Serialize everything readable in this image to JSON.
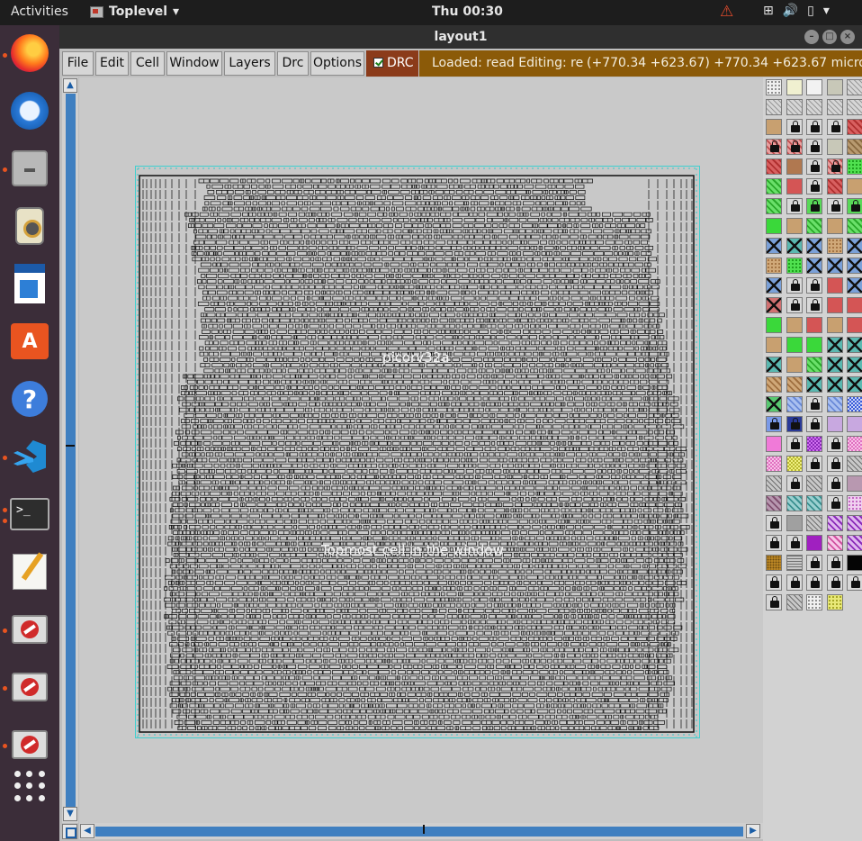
{
  "topbar": {
    "activities": "Activities",
    "app_name": "Toplevel",
    "app_chevron": "▾",
    "clock": "Thu 00:30",
    "warning_icon": "⚠",
    "tray": {
      "network": "⊞",
      "volume": "🔊",
      "battery": "▯",
      "power": "▾"
    }
  },
  "dock": {
    "items": [
      {
        "name": "firefox-icon"
      },
      {
        "name": "thunderbird-icon"
      },
      {
        "name": "files-icon"
      },
      {
        "name": "rhythmbox-icon"
      },
      {
        "name": "libreoffice-writer-icon"
      },
      {
        "name": "software-store-icon",
        "glyph": "A"
      },
      {
        "name": "help-icon",
        "glyph": "?"
      },
      {
        "name": "vscode-icon"
      },
      {
        "name": "terminal-icon",
        "glyph": ">_"
      },
      {
        "name": "text-editor-icon"
      },
      {
        "name": "blocked-app-icon"
      },
      {
        "name": "blocked-app-icon"
      },
      {
        "name": "blocked-app-icon"
      }
    ]
  },
  "window": {
    "title": "layout1",
    "controls": {
      "minimize": "–",
      "maximize": "□",
      "close": "×"
    }
  },
  "menubar": {
    "items": [
      "File",
      "Edit",
      "Cell",
      "Window",
      "Layers",
      "Drc",
      "Options"
    ],
    "drc_toggle": {
      "label": "DRC",
      "checked": true
    }
  },
  "status": {
    "message": "Loaded: read Editing: re",
    "coords": "(+770.34 +623.67) +770.34 +623.67 microns"
  },
  "canvas": {
    "cell_name": "picorv32a",
    "cell_note": "Topmost cell in the window",
    "boundary_color": "#3fd0d0"
  },
  "scrollbars": {
    "up": "▲",
    "down": "▼",
    "left": "◀",
    "right": "▶"
  },
  "palette": {
    "rows": [
      [
        "dots-white",
        "yellow-box",
        "white-box",
        "gray-solid",
        "hatch-gray"
      ],
      [
        "hatch-gray",
        "hatch-gray",
        "hatch-gray",
        "hatch-gray",
        "hatch-gray"
      ],
      [
        "tan",
        "lock",
        "lock",
        "lock",
        "red-hatch"
      ],
      [
        "lock-red",
        "lock-red",
        "lock",
        "gray-solid",
        "brown-hatch"
      ],
      [
        "red-hatch",
        "brown",
        "lock",
        "lock-red",
        "green-dots"
      ],
      [
        "green-hatch",
        "red",
        "lock",
        "red-hatch",
        "tan"
      ],
      [
        "green-hatch",
        "lock",
        "lock-green",
        "lock",
        "lock-green"
      ],
      [
        "green",
        "tan",
        "green-hatch",
        "tan",
        "green-hatch"
      ],
      [
        "x-blue",
        "x-teal",
        "x-blue",
        "tan-dots",
        "x-blue"
      ],
      [
        "tan-dots",
        "green-dots",
        "x-blue",
        "x-blue",
        "x-blue"
      ],
      [
        "x-blue",
        "lock",
        "lock",
        "red",
        "x-blue"
      ],
      [
        "x-red",
        "lock",
        "lock",
        "red",
        "red"
      ],
      [
        "green",
        "tan",
        "red",
        "tan",
        "red"
      ],
      [
        "tan",
        "green",
        "green",
        "x-teal",
        "x-teal"
      ],
      [
        "x-teal",
        "tan",
        "green-hatch",
        "x-teal",
        "x-teal"
      ],
      [
        "tan-hatch",
        "tan-hatch",
        "x-teal",
        "x-teal",
        "x-teal"
      ],
      [
        "x-green",
        "blue-hatch",
        "lock",
        "blue-hatch",
        "blue-check"
      ],
      [
        "lock-blue",
        "lock-navy",
        "lock",
        "lavender",
        "lavender"
      ],
      [
        "pink",
        "lock",
        "purple-check",
        "lock",
        "pink-check"
      ],
      [
        "pink-check",
        "yellow-check",
        "lock",
        "lock",
        "gray-hatch"
      ],
      [
        "gray-hatch",
        "lock",
        "gray-hatch",
        "lock",
        "mauve"
      ],
      [
        "mauve-hatch",
        "teal-hatch",
        "teal-hatch",
        "lock",
        "pink-dots"
      ],
      [
        "lock",
        "gray",
        "gray-hatch",
        "purple-hatch",
        "purple-hatch"
      ],
      [
        "lock",
        "lock",
        "purple",
        "pink-hatch",
        "purple-hatch"
      ],
      [
        "orange-speckle",
        "gray-lines",
        "lock",
        "lock",
        "black"
      ],
      [
        "lock",
        "lock",
        "lock",
        "lock",
        "lock"
      ],
      [
        "lock",
        "gray-hatch",
        "dots-white",
        "yellow-dots",
        ""
      ]
    ]
  }
}
